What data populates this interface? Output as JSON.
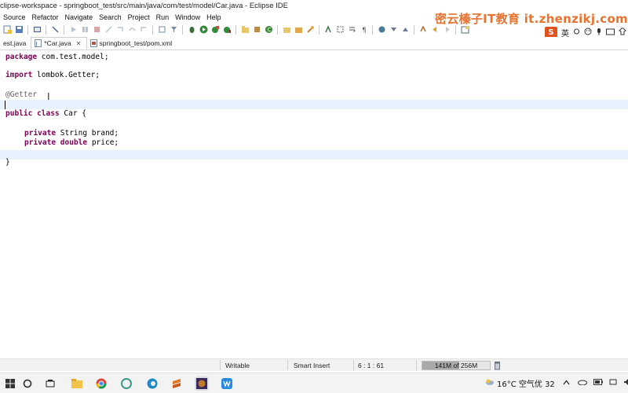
{
  "window": {
    "title": "clipse-workspace - springboot_test/src/main/java/com/test/model/Car.java - Eclipse IDE"
  },
  "watermark": {
    "text": "密云榛子IT教育 it.zhenzikj.com"
  },
  "menubar": {
    "items": [
      "Source",
      "Refactor",
      "Navigate",
      "Search",
      "Project",
      "Run",
      "Window",
      "Help"
    ]
  },
  "ime": {
    "logo": "S",
    "lang": "英"
  },
  "tabs": [
    {
      "label": "est.java",
      "closable": false,
      "active": false
    },
    {
      "label": "*Car.java",
      "closable": true,
      "active": true
    },
    {
      "label": "springboot_test/pom.xml",
      "closable": false,
      "active": false
    }
  ],
  "editor": {
    "lines": [
      {
        "kw": "package",
        "rest": " com.test.model;"
      },
      {
        "kw": "import",
        "rest": " lombok.Getter;"
      },
      {
        "anno": "@Getter"
      },
      {
        "kw": "public",
        "kw2": "class",
        "rest": " Car {"
      },
      {
        "kw": "private",
        "rest": " String brand;"
      },
      {
        "kw": "private",
        "kw2": "double",
        "rest": " price;"
      },
      {
        "rest": "}"
      }
    ]
  },
  "statusbar": {
    "writable": "Writable",
    "insert_mode": "Smart Insert",
    "position": "6 : 1 : 61",
    "heap": "141M of 256M",
    "heap_used_fraction": 0.55
  },
  "tray": {
    "weather": "16°C 空气优 32"
  },
  "colors": {
    "keyword": "#7f0055",
    "annotation": "#646464",
    "current_line": "#e8f2fe",
    "watermark": "#e8722e"
  }
}
